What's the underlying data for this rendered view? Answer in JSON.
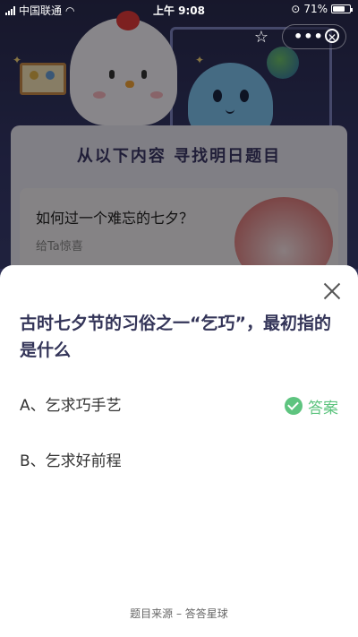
{
  "status_bar": {
    "carrier": "中国联通",
    "time": "上午 9:08",
    "battery": "71%",
    "battery_level": 0.71
  },
  "background": {
    "card_title": "从以下内容 寻找明日题目",
    "question": "如何过一个难忘的七夕？",
    "subtitle": "给Ta惊喜"
  },
  "sheet": {
    "question": "古时七夕节的习俗之一“乞巧”，最初指的是什么",
    "options": [
      {
        "label": "A、乞求巧手艺"
      },
      {
        "label": "B、乞求好前程"
      }
    ],
    "answer_label": "答案",
    "source": "题目来源 – 答答星球"
  },
  "colors": {
    "accent_green": "#5ec47f",
    "question_text": "#333458",
    "bg_dark": "#2d2f55"
  }
}
